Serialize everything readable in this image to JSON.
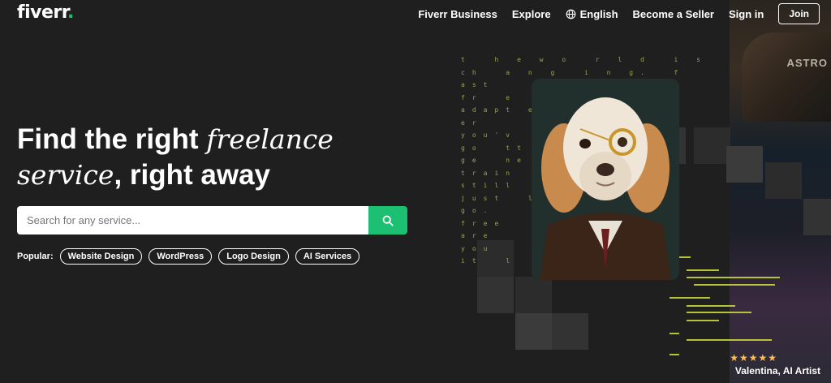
{
  "header": {
    "logo_text": "fiverr",
    "logo_dot": ".",
    "nav": {
      "business": "Fiverr Business",
      "explore": "Explore",
      "language": "English",
      "become_seller": "Become a Seller",
      "sign_in": "Sign in",
      "join": "Join"
    }
  },
  "hero": {
    "title_part1": "Find the right ",
    "title_italic1": "freelance",
    "title_italic2": "service",
    "title_part2": ", right away",
    "search": {
      "placeholder": "Search for any service..."
    },
    "popular_label": "Popular:",
    "popular": [
      "Website Design",
      "WordPress",
      "Logo Design",
      "AI Services"
    ]
  },
  "art": {
    "code_text": "t  h e w o  r l d  i s\nch  a n g  i n g.  f\nast\nfr  e  e\nadapt e\ner\nyou'v  e\ngo  tt\nge  ne\ntrain\nstill\njust  l\ngo.\nfree\nare\nyou\nit  l",
    "sign_text": "ASTRO",
    "rating_stars": "★★★★★",
    "credit": "Valentina, AI Artist"
  },
  "colors": {
    "accent": "#1dbf73",
    "background": "#1f1f1f",
    "code": "#b7c23a"
  }
}
